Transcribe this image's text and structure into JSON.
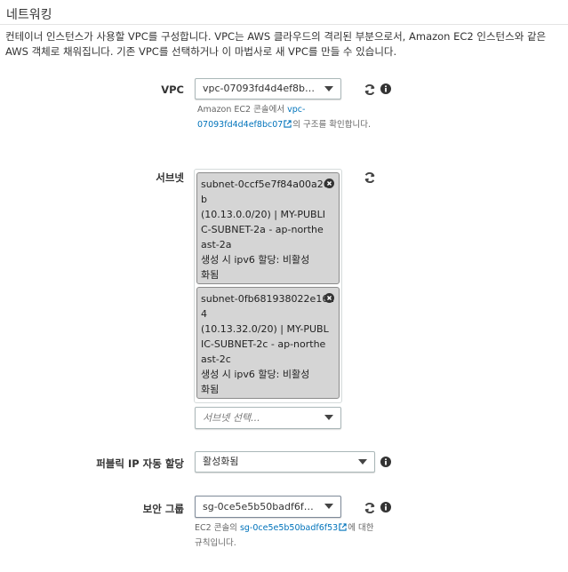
{
  "section": {
    "title": "네트워킹",
    "description": "컨테이너 인스턴스가 사용할 VPC를 구성합니다. VPC는 AWS 클라우드의 격리된 부분으로서, Amazon EC2 인스턴스와 같은 AWS 객체로 채워집니다. 기존 VPC를 선택하거나 이 마법사로 새 VPC를 만들 수 있습니다."
  },
  "vpc": {
    "label": "VPC",
    "selected": "vpc-07093fd4d4ef8bc07...",
    "help_prefix": "Amazon EC2 콘솔에서 ",
    "help_link_line1": "vpc-",
    "help_link_line2": "07093fd4d4ef8bc07",
    "help_suffix": "의 구조를 확인합니다."
  },
  "subnets": {
    "label": "서브넷",
    "tokens": [
      {
        "lines": [
          "subnet-0ccf5e7f84a00a26",
          "b",
          "(10.13.0.0/20) | MY-PUBLI",
          "C-SUBNET-2a - ap-northe",
          "ast-2a",
          "생성 시 ipv6 할당: 비활성",
          "화됨"
        ]
      },
      {
        "lines": [
          "subnet-0fb681938022e16a",
          "4",
          "(10.13.32.0/20) | MY-PUBL",
          "IC-SUBNET-2c - ap-northe",
          "ast-2c",
          "생성 시 ipv6 할당: 비활성",
          "화됨"
        ]
      }
    ],
    "placeholder": "서브넷 선택..."
  },
  "public_ip": {
    "label": "퍼블릭 IP 자동 할당",
    "selected": "활성화됨"
  },
  "security_group": {
    "label": "보안 그룹",
    "selected": "sg-0ce5e5b50badf6f53 ...",
    "help_prefix": "EC2 콘솔의 ",
    "help_link": "sg-0ce5e5b50badf6f53",
    "help_suffix": "에 대한",
    "help_line2": "규칙입니다."
  },
  "icons": [
    "refresh-icon",
    "info-icon",
    "chevron-down-icon",
    "close-icon",
    "external-link-icon"
  ]
}
